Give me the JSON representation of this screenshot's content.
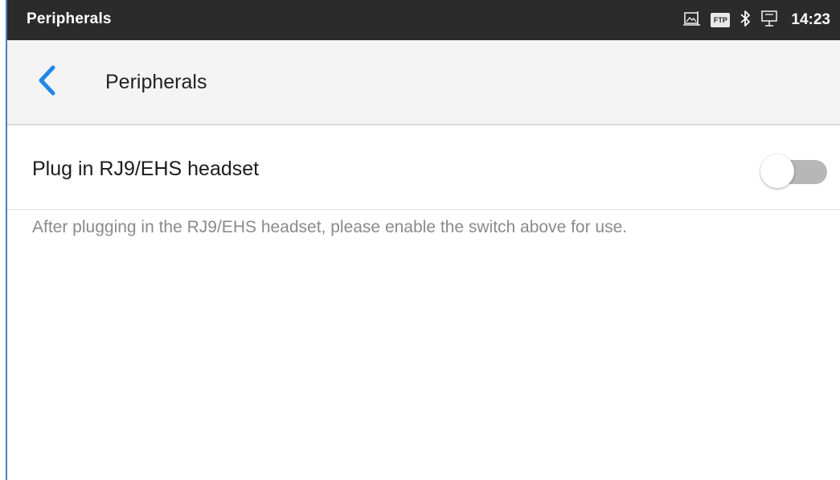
{
  "statusbar": {
    "app_title": "Peripherals",
    "ftp_label": "FTP",
    "time": "14:23",
    "icons": [
      "screenshot-icon",
      "ftp-icon",
      "bluetooth-icon",
      "network-icon"
    ]
  },
  "appbar": {
    "title": "Peripherals",
    "back_icon": "chevron-left-icon"
  },
  "settings": {
    "headset": {
      "label": "Plug in RJ9/EHS headset",
      "enabled": false,
      "hint": "After plugging in the RJ9/EHS headset, please enable the switch above for use."
    }
  },
  "colors": {
    "accent": "#1e88e5",
    "statusbar_bg": "#2b2b2b",
    "appbar_bg": "#f4f4f4",
    "switch_off_track": "#b7b7b7",
    "hint_text": "#8a8a8a"
  }
}
